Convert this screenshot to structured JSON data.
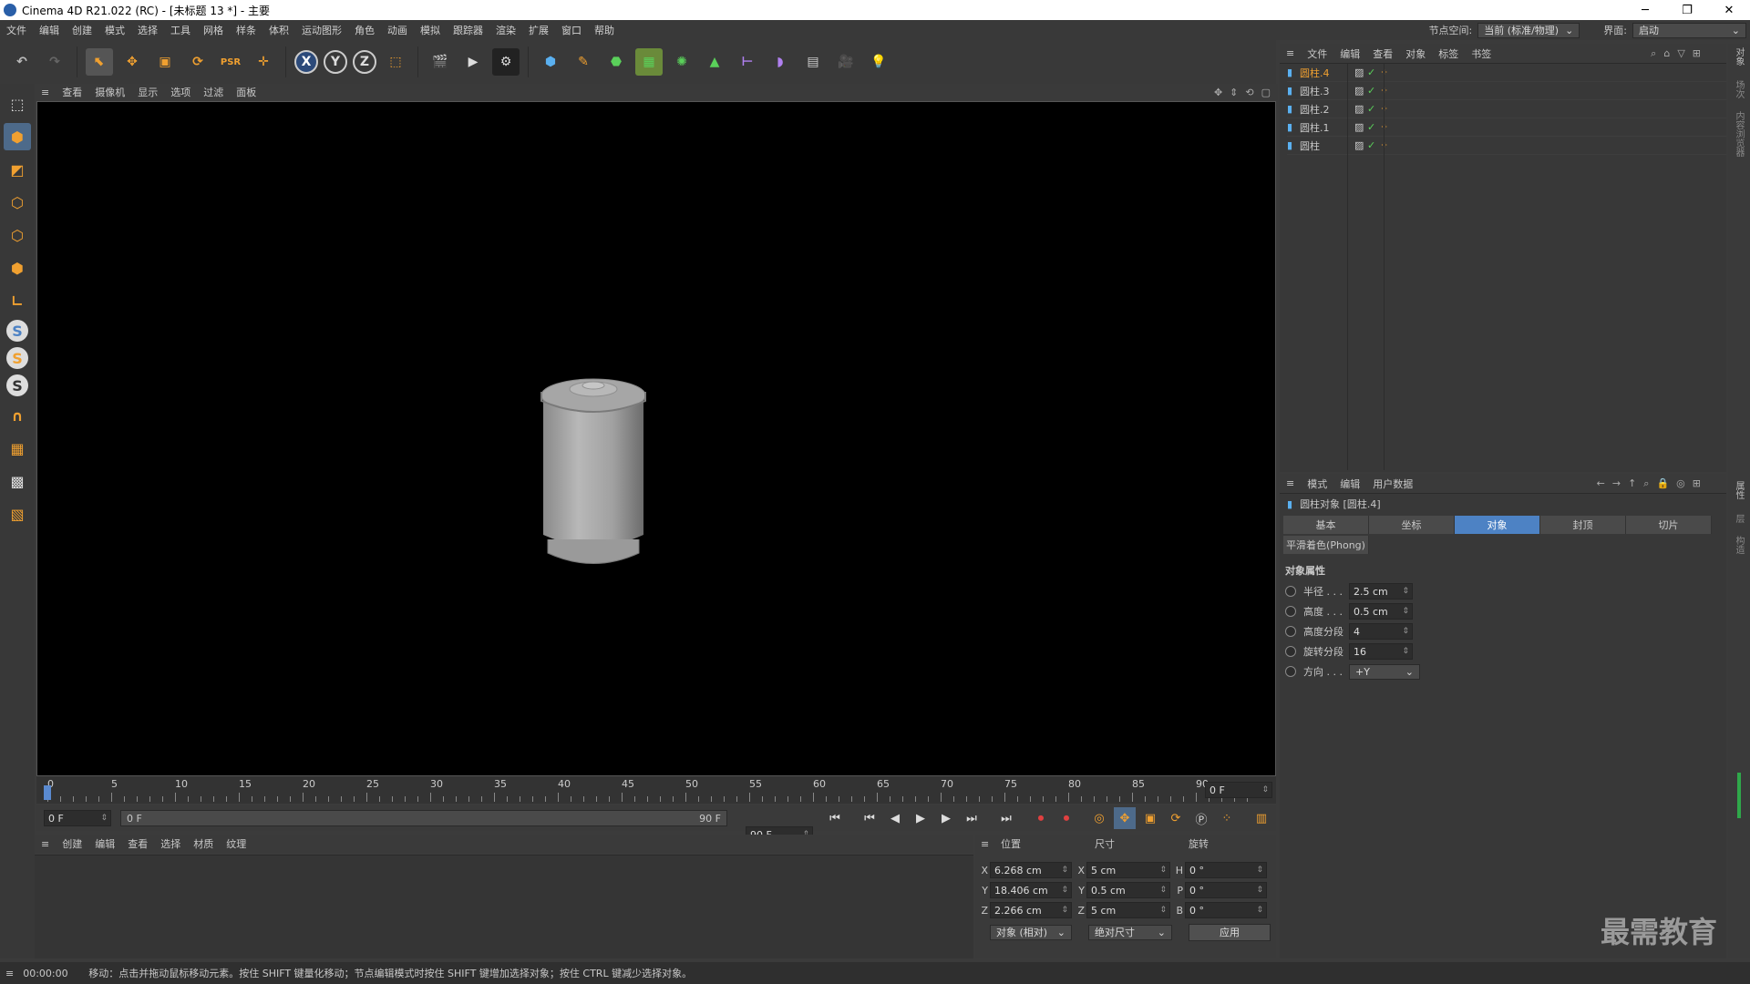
{
  "title_bar": {
    "text": "Cinema 4D R21.022 (RC) - [未标题 13 *] - 主要",
    "minimize": "─",
    "restore": "❐",
    "close": "✕"
  },
  "menu": {
    "items": [
      "文件",
      "编辑",
      "创建",
      "模式",
      "选择",
      "工具",
      "网格",
      "样条",
      "体积",
      "运动图形",
      "角色",
      "动画",
      "模拟",
      "跟踪器",
      "渲染",
      "扩展",
      "窗口",
      "帮助"
    ],
    "node_space_label": "节点空间:",
    "node_space_value": "当前 (标准/物理)",
    "layout_label": "界面:",
    "layout_value": "启动"
  },
  "toolbar": {
    "x_label": "X",
    "y_label": "Y",
    "z_label": "Z"
  },
  "viewport_menu": [
    "查看",
    "摄像机",
    "显示",
    "选项",
    "过滤",
    "面板"
  ],
  "timeline": {
    "ticks": [
      "0",
      "5",
      "10",
      "15",
      "20",
      "25",
      "30",
      "35",
      "40",
      "45",
      "50",
      "55",
      "60",
      "65",
      "70",
      "75",
      "80",
      "85",
      "90"
    ],
    "current_frame": "0 F",
    "start_field": "0 F",
    "range_start": "0 F",
    "range_end": "90 F",
    "end_field": "90 F"
  },
  "material_menu": [
    "创建",
    "编辑",
    "查看",
    "选择",
    "材质",
    "纹理"
  ],
  "coordinates": {
    "pos_header": "位置",
    "size_header": "尺寸",
    "rot_header": "旋转",
    "rows": [
      {
        "axis": "X",
        "pos": "6.268 cm",
        "saxis": "X",
        "size": "5 cm",
        "raxis": "H",
        "rot": "0 °"
      },
      {
        "axis": "Y",
        "pos": "18.406 cm",
        "saxis": "Y",
        "size": "0.5 cm",
        "raxis": "P",
        "rot": "0 °"
      },
      {
        "axis": "Z",
        "pos": "2.266 cm",
        "saxis": "Z",
        "size": "5 cm",
        "raxis": "B",
        "rot": "0 °"
      }
    ],
    "mode_select": "对象 (相对)",
    "size_select": "绝对尺寸",
    "apply_button": "应用"
  },
  "object_manager": {
    "menu": [
      "文件",
      "编辑",
      "查看",
      "对象",
      "标签",
      "书签"
    ],
    "objects": [
      {
        "name": "圆柱.4",
        "selected": true
      },
      {
        "name": "圆柱.3",
        "selected": false
      },
      {
        "name": "圆柱.2",
        "selected": false
      },
      {
        "name": "圆柱.1",
        "selected": false
      },
      {
        "name": "圆柱",
        "selected": false
      }
    ]
  },
  "attributes": {
    "menu": [
      "模式",
      "编辑",
      "用户数据"
    ],
    "object_title": "圆柱对象 [圆柱.4]",
    "tabs": [
      "基本",
      "坐标",
      "对象",
      "封顶",
      "切片"
    ],
    "active_tab": "对象",
    "phong_tab": "平滑着色(Phong)",
    "section": "对象属性",
    "props": [
      {
        "label": "半径 . . .",
        "value": "2.5 cm"
      },
      {
        "label": "高度 . . .",
        "value": "0.5 cm"
      },
      {
        "label": "高度分段",
        "value": "4"
      },
      {
        "label": "旋转分段",
        "value": "16"
      },
      {
        "label": "方向 . . .",
        "value": "+Y"
      }
    ]
  },
  "right_strip": [
    "对象",
    "场次",
    "内容浏览器",
    "属性",
    "层",
    "构造"
  ],
  "status": {
    "time": "00:00:00",
    "message": "移动：点击并拖动鼠标移动元素。按住 SHIFT 键量化移动；节点编辑模式时按住 SHIFT 键增加选择对象；按住 CTRL 键减少选择对象。"
  },
  "watermark": "最需教育",
  "colors": {
    "accent": "#4d82c4",
    "selected_text": "#f0a030",
    "viewport_bg": "#000000"
  }
}
